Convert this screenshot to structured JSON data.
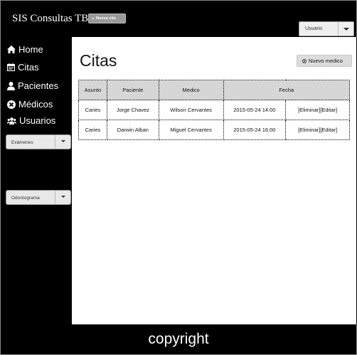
{
  "header": {
    "brand": "SIS Consultas TB",
    "nueva_cita_label": "Nueva cita",
    "user_select_value": "Usuario"
  },
  "sidebar": {
    "items": [
      {
        "label": "Home",
        "icon": "home-icon"
      },
      {
        "label": "Citas",
        "icon": "calendar-icon"
      },
      {
        "label": "Pacientes",
        "icon": "user-icon"
      },
      {
        "label": "Médicos",
        "icon": "times-circle-icon"
      },
      {
        "label": "Usuarios",
        "icon": "users-icon"
      }
    ],
    "examenes_select_value": "Exámenes",
    "odontograma_select_value": "Odontograma"
  },
  "main": {
    "title": "Citas",
    "nuevo_medico_label": "Nuevo medico",
    "table": {
      "headers": [
        "Asunto",
        "Paciente",
        "Medico",
        "Fecha"
      ],
      "rows": [
        {
          "asunto": "Caries",
          "paciente": "Jorge Chavez",
          "medico": "Wilson Cervantes",
          "fecha": "2015-05-24 14:00",
          "acciones": "[Eliminar][Editar]"
        },
        {
          "asunto": "Caries",
          "paciente": "Darwin Alban",
          "medico": "Miguel Cervantes",
          "fecha": "2015-05-24 16:00",
          "acciones": "[Eliminar][Editar]"
        }
      ]
    }
  },
  "footer": {
    "copyright": "copyright"
  }
}
